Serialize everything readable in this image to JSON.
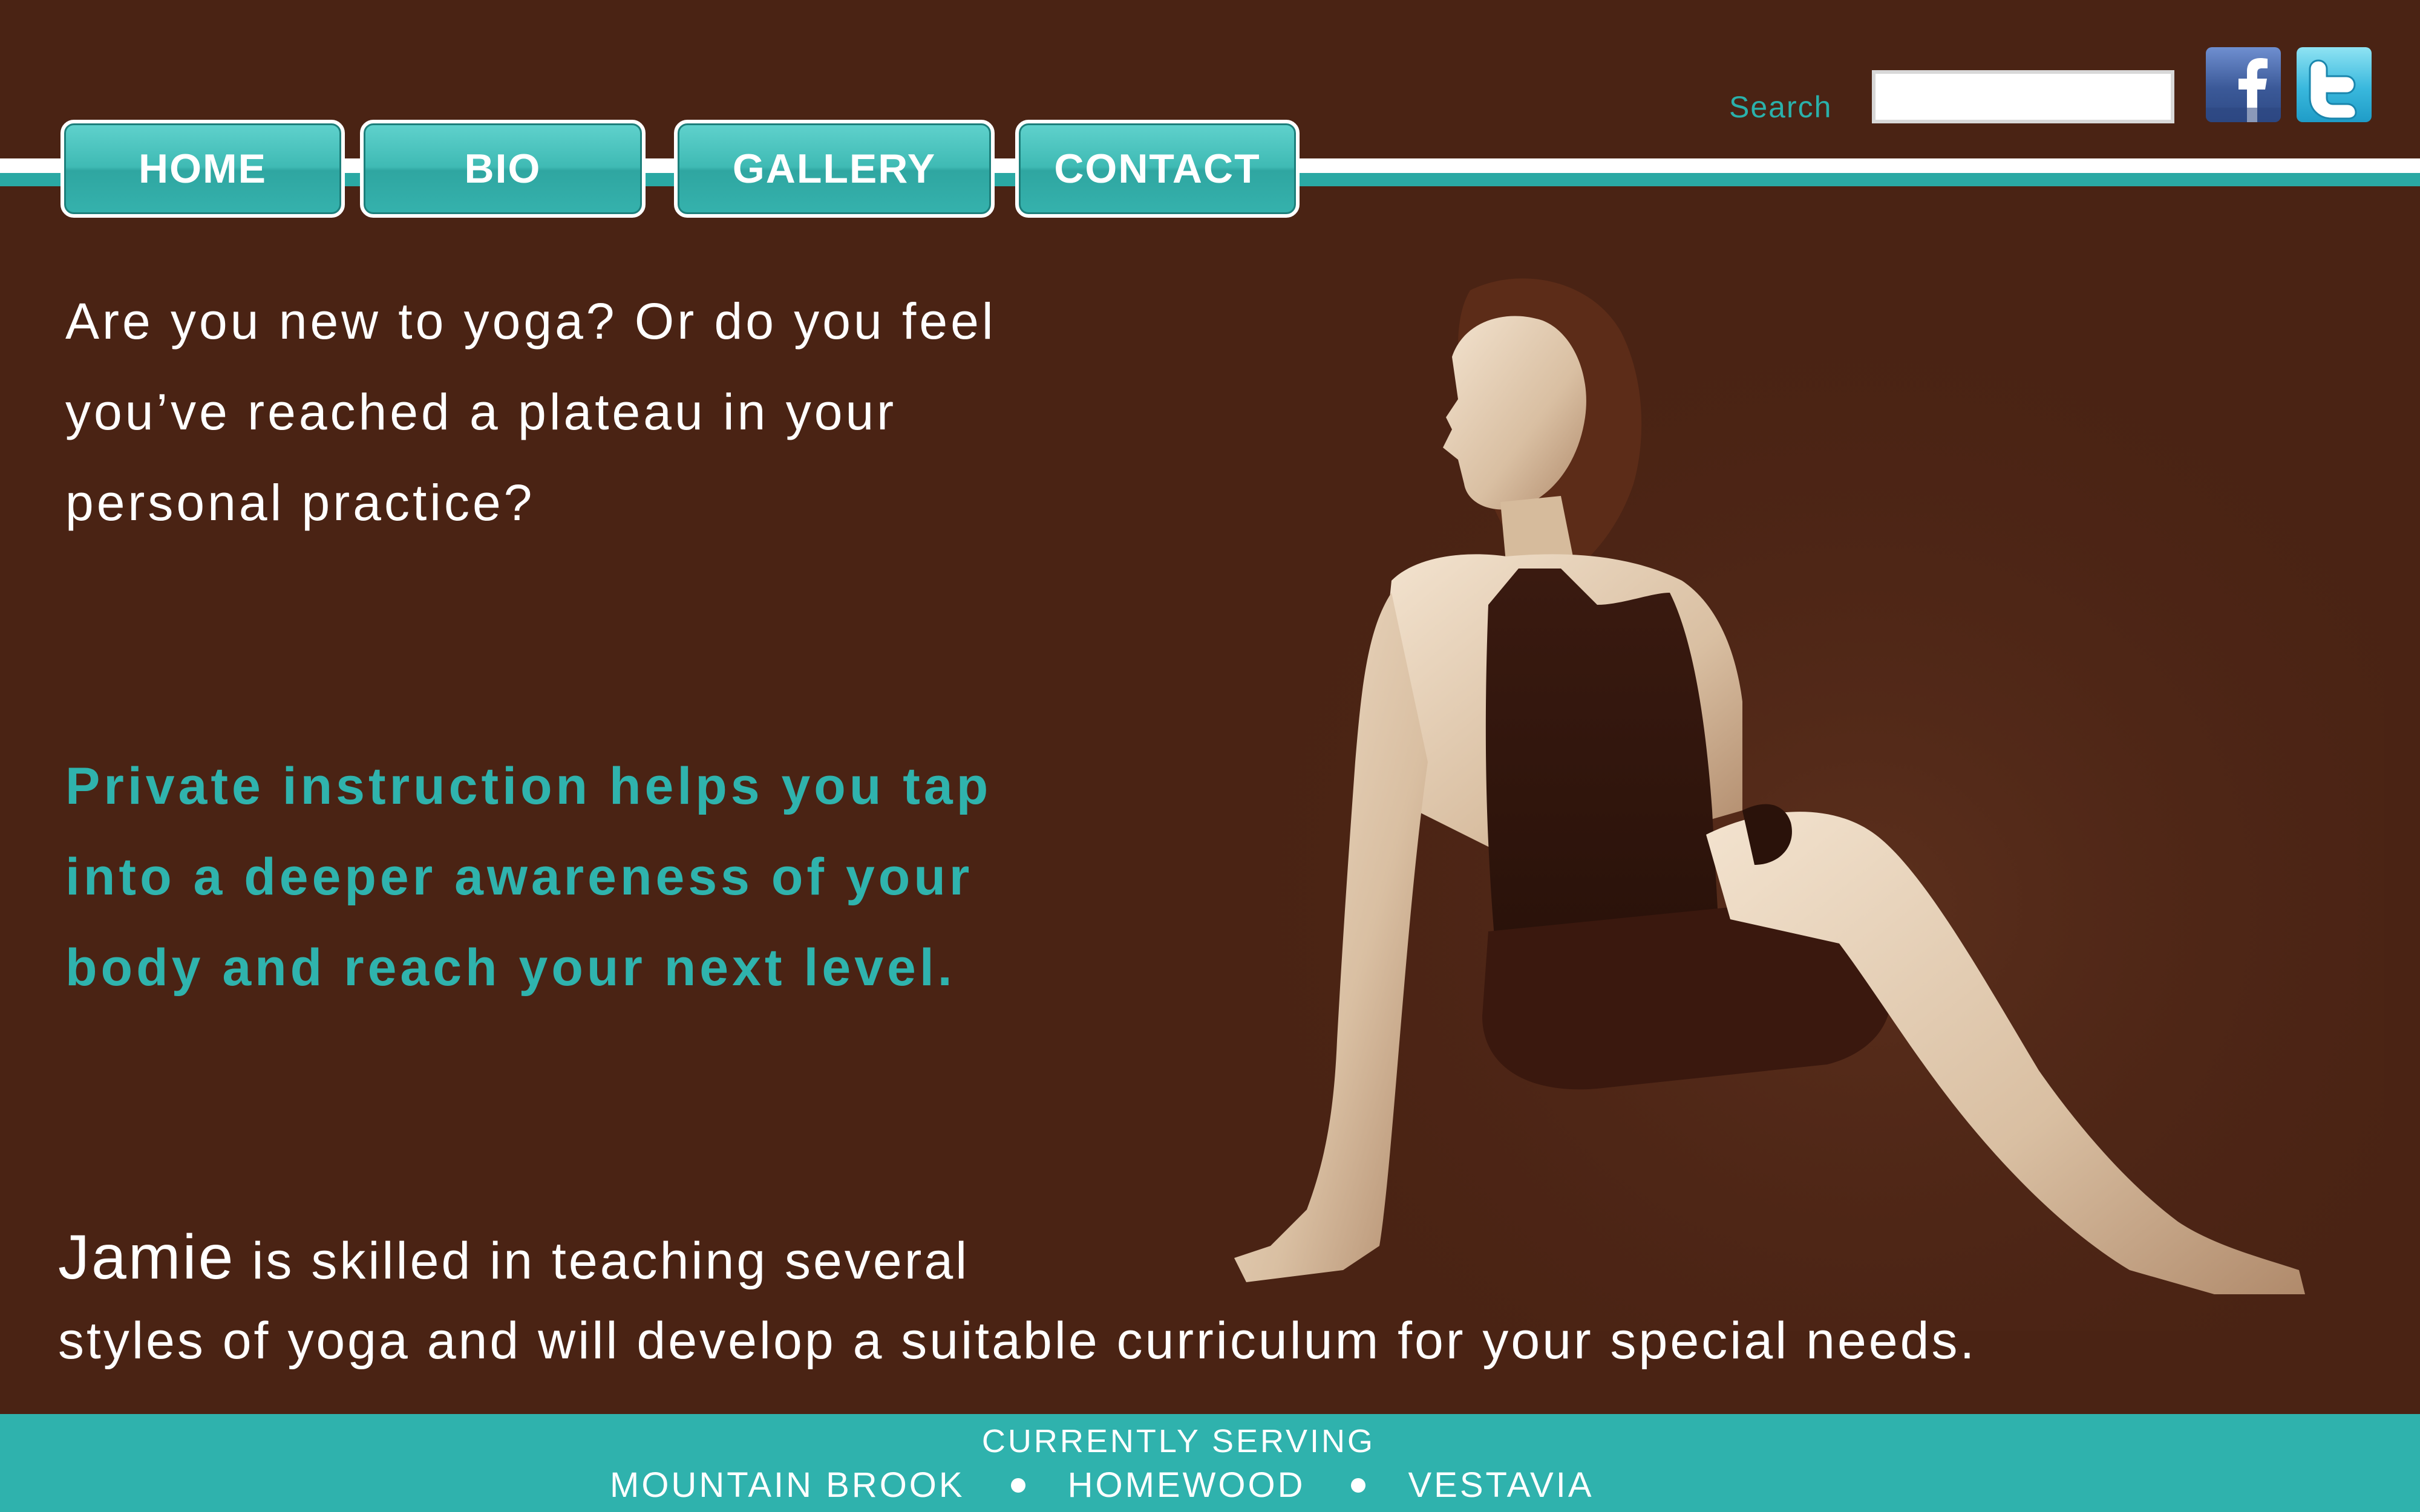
{
  "nav": {
    "items": [
      {
        "label": "HOME"
      },
      {
        "label": "BIO"
      },
      {
        "label": "GALLERY"
      },
      {
        "label": "CONTACT"
      }
    ]
  },
  "search": {
    "label": "Search",
    "value": "",
    "placeholder": ""
  },
  "social": {
    "facebook_icon": "facebook-icon",
    "twitter_icon": "twitter-icon"
  },
  "content": {
    "intro_lines": [
      "Are you new to yoga? Or do you feel",
      "you’ve reached a plateau in your",
      "personal practice?"
    ],
    "pitch_lines": [
      "Private instruction helps you tap",
      "into a deeper awareness of your",
      "body and reach your next level."
    ],
    "bio_name": "Jamie",
    "bio_line1_rest": " is skilled in teaching several",
    "bio_line2": "styles of yoga and will develop a suitable curriculum for your special needs."
  },
  "footer": {
    "title": "CURRENTLY SERVING",
    "areas": [
      "MOUNTAIN BROOK",
      "HOMEWOOD",
      "VESTAVIA"
    ]
  },
  "colors": {
    "background": "#4a2314",
    "accent_teal": "#2fb2ad",
    "text": "#ffffff"
  }
}
